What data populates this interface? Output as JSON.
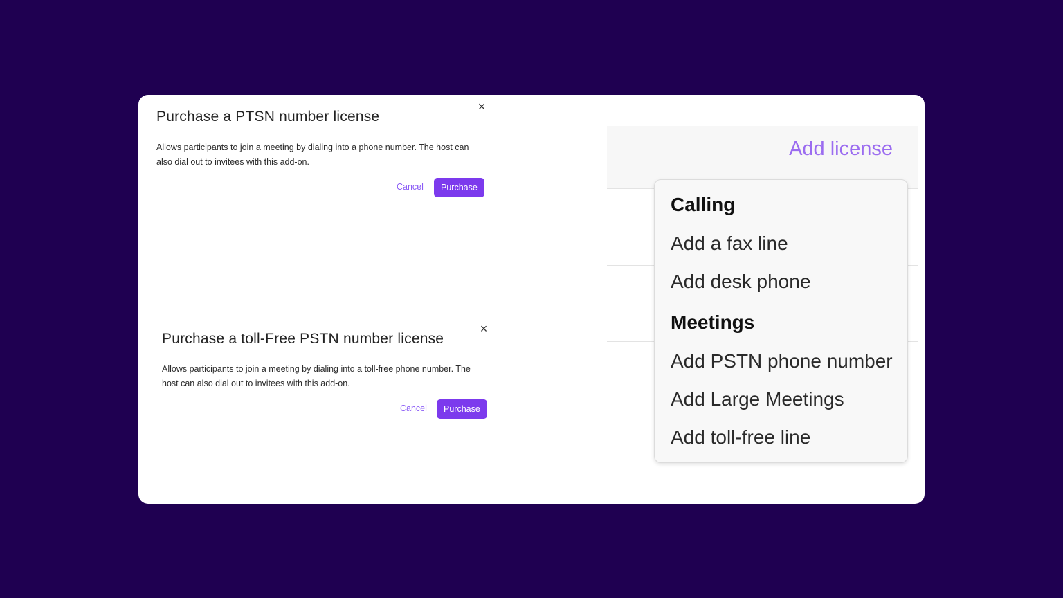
{
  "dialog_ptsn": {
    "title": "Purchase a PTSN number license",
    "description": "Allows participants to join a meeting by dialing into a phone number. The host can also dial out to invitees with this add-on.",
    "close_glyph": "×",
    "cancel_label": "Cancel",
    "purchase_label": "Purchase"
  },
  "dialog_tollfree": {
    "title": "Purchase a toll-Free PSTN number license",
    "description": "Allows participants to join a meeting by dialing into a toll-free phone number. The host can also dial out to invitees with this add-on.",
    "close_glyph": "×",
    "cancel_label": "Cancel",
    "purchase_label": "Purchase"
  },
  "license_panel": {
    "add_license_label": "Add license"
  },
  "license_menu": {
    "calling_heading": "Calling",
    "calling_items": [
      "Add a fax line",
      "Add desk phone"
    ],
    "meetings_heading": "Meetings",
    "meetings_items": [
      "Add PSTN phone number",
      "Add Large Meetings",
      "Add toll-free line"
    ]
  },
  "colors": {
    "background": "#1f0051",
    "accent": "#7c3aed",
    "link": "#8b5cf6"
  },
  "icons": {
    "close": "close-icon"
  }
}
